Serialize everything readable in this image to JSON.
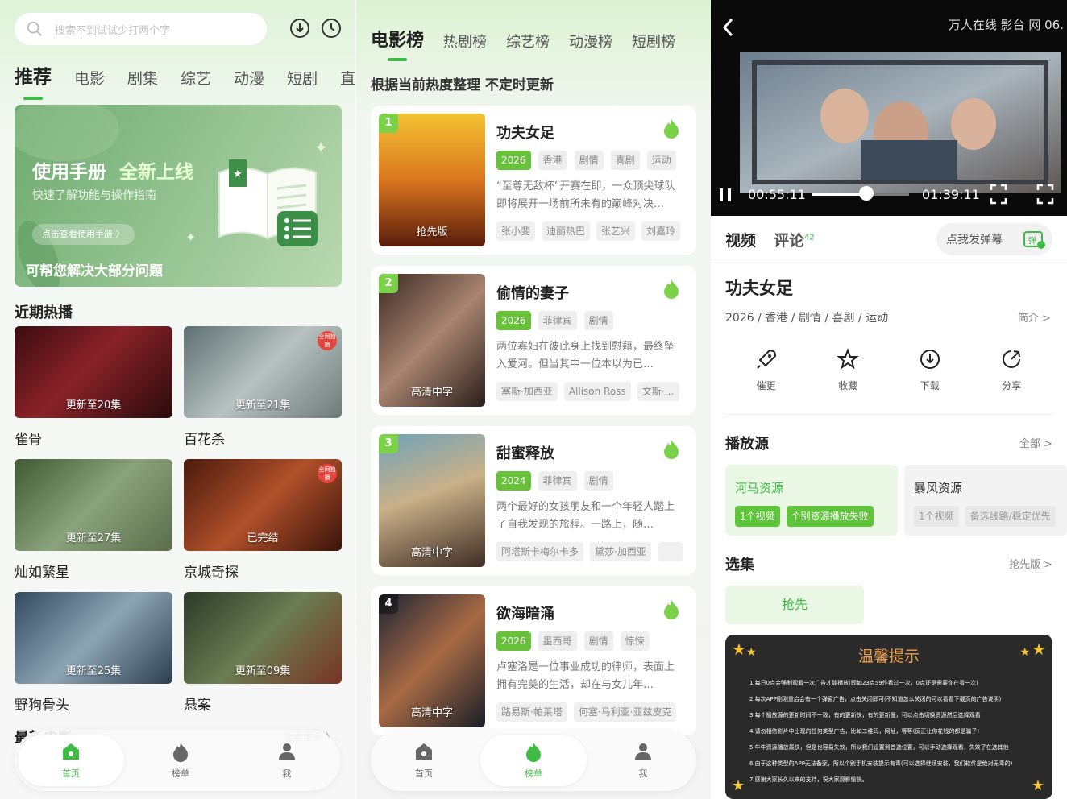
{
  "home": {
    "search_placeholder": "搜索不到试试少打两个字",
    "tabs": [
      "推荐",
      "电影",
      "剧集",
      "综艺",
      "动漫",
      "短剧",
      "直"
    ],
    "banner": {
      "title_a": "使用手册",
      "title_b": "全新上线",
      "subtitle": "快速了解功能与操作指南",
      "button": "点击查看使用手册 〉",
      "footer": "可帮您解决大部分问题"
    },
    "section_recent": "近期热播",
    "cards": [
      {
        "name": "雀骨",
        "ep": "更新至20集",
        "badge": ""
      },
      {
        "name": "百花杀",
        "ep": "更新至21集",
        "badge": "全网独播"
      },
      {
        "name": "灿如繁星",
        "ep": "更新至27集",
        "badge": ""
      },
      {
        "name": "京城奇探",
        "ep": "已完结",
        "badge": "全网独播"
      },
      {
        "name": "野狗骨头",
        "ep": "更新至25集",
        "badge": ""
      },
      {
        "name": "悬案",
        "ep": "更新至09集",
        "badge": ""
      }
    ],
    "section_latest": "最新电影",
    "more": "查看更多 〉"
  },
  "nav": {
    "home": "首页",
    "rank": "榜单",
    "me": "我"
  },
  "rank": {
    "tabs": [
      "电影榜",
      "热剧榜",
      "综艺榜",
      "动漫榜",
      "短剧榜"
    ],
    "subtitle": "根据当前热度整理 不定时更新",
    "items": [
      {
        "num": "1",
        "title": "功夫女足",
        "year": "2026",
        "tags": [
          "香港",
          "剧情",
          "喜剧",
          "运动"
        ],
        "desc": "“至尊无敌杯”开赛在即，一众顶尖球队即将展开一场前所未有的巅峰对决…",
        "cast": [
          "张小斐",
          "迪丽热巴",
          "张艺兴",
          "刘嘉玲"
        ],
        "overlay": "抢先版"
      },
      {
        "num": "2",
        "title": "偷情的妻子",
        "year": "2026",
        "tags": [
          "菲律宾",
          "剧情"
        ],
        "desc": "两位寡妇在彼此身上找到慰藉，最终坠入爱河。但当其中一位本以为已…",
        "cast": [
          "塞斯·加西亚",
          "Allison Ross",
          "文斯·…"
        ],
        "overlay": "高清中字"
      },
      {
        "num": "3",
        "title": "甜蜜释放",
        "year": "2024",
        "tags": [
          "菲律宾",
          "剧情"
        ],
        "desc": "两个最好的女孩朋友和一个年轻人踏上了自我发现的旅程。一路上，随…",
        "cast": [
          "阿塔斯卡梅尔卡多",
          "黛莎·加西亚",
          ""
        ],
        "overlay": "高清中字"
      },
      {
        "num": "4",
        "title": "欲海暗涌",
        "year": "2026",
        "tags": [
          "墨西哥",
          "剧情",
          "惊悚"
        ],
        "desc": "卢塞洛是一位事业成功的律师，表面上拥有完美的生活，却在与女儿年…",
        "cast": [
          "路易斯·帕莱塔",
          "何塞·马利亚·亚兹皮克"
        ],
        "overlay": "高清中字"
      }
    ]
  },
  "detail": {
    "watermark": "万人在线 影台 网 06.",
    "time_current": "00:55:11",
    "time_total": "01:39:11",
    "progress": 0.56,
    "tab_video": "视频",
    "tab_comment": "评论",
    "comment_count": "42",
    "danmu": "点我发弹幕",
    "title": "功夫女足",
    "meta": "2026 / 香港 / 剧情 / 喜剧 / 运动",
    "intro": "简介 >",
    "actions": [
      "催更",
      "收藏",
      "下载",
      "分享"
    ],
    "source_title": "播放源",
    "source_all": "全部 >",
    "sources": [
      {
        "name": "河马资源",
        "chips": [
          "1个视频",
          "个别资源播放失败"
        ]
      },
      {
        "name": "暴风资源",
        "chips": [
          "1个视频",
          "备选线路/稳定优先"
        ]
      }
    ],
    "episodes_title": "选集",
    "episodes_side": "抢先版 >",
    "episode_button": "抢先",
    "notice_title": "温馨提示",
    "notice_lines": [
      "1.每日0点会强制观看一次广告才能播放(即如23点59作看过一次，0点还是需要你在看一次)",
      "2.每次APP刚刚重启会有一个弹窗广告，点击关闭即可(不知道怎么关闭的可以看看下载页的广告说明)",
      "3.每个播放源的更新时间不一致，有的更新快，有的更新慢，可以点击切换资源然后选择观看",
      "4.请勿相信影片中出现的任何类型广告，比如二维码，网址，等等(反正让你花钱的都是骗子)",
      "5.牛牛资源播放最快，但是也容易失效，所以我们设置到首选位置，可以手动选择观看，失效了在选其他",
      "6.由于这种类型的APP无法备案，所以个别手机安装提示有毒(可以选择继续安装，我们软件是绝对无毒的)",
      "7.感谢大家长久以来的支持，祝大家观影愉快。"
    ]
  },
  "colors": {
    "accent": "#3dbb45",
    "tag_year": "#67c23a",
    "notice_title": "#f0a04a"
  }
}
